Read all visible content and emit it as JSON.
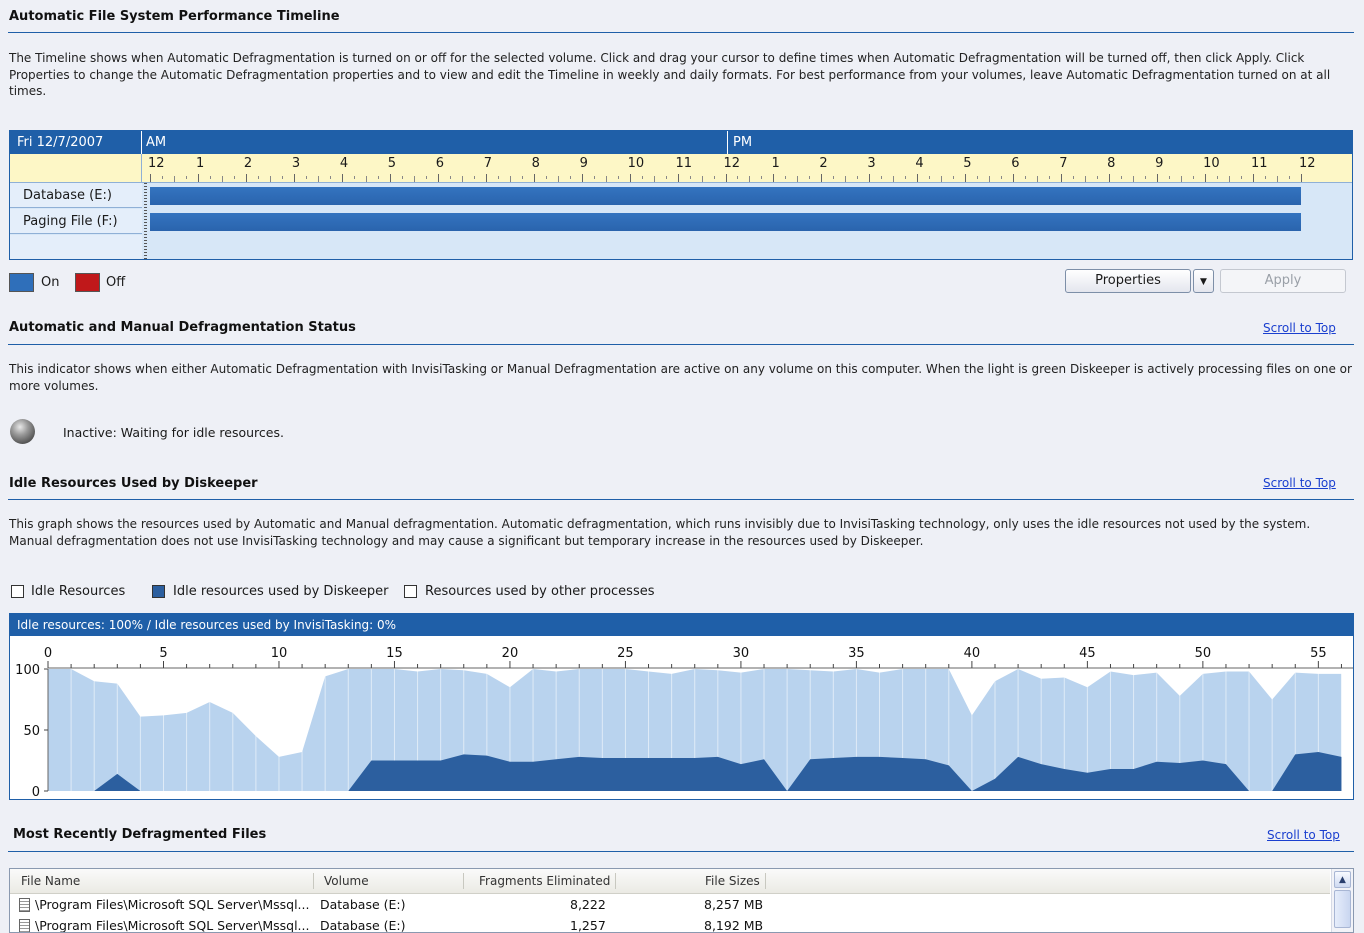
{
  "timeline_section": {
    "title": "Automatic File System Performance Timeline",
    "description": "The Timeline shows when Automatic Defragmentation is turned on or off for the selected volume. Click and drag your cursor to define times when Automatic Defragmentation will be turned off, then click Apply. Click Properties to change the Automatic Defragmentation properties and to view and edit the Timeline in weekly and daily formats. For best performance from your volumes, leave Automatic Defragmentation turned on at all times.",
    "date": "Fri 12/7/2007",
    "am_label": "AM",
    "pm_label": "PM",
    "hours": [
      "12",
      "1",
      "2",
      "3",
      "4",
      "5",
      "6",
      "7",
      "8",
      "9",
      "10",
      "11",
      "12",
      "1",
      "2",
      "3",
      "4",
      "5",
      "6",
      "7",
      "8",
      "9",
      "10",
      "11",
      "12"
    ],
    "volumes": [
      {
        "name": "Database (E:)",
        "state": "On"
      },
      {
        "name": "Paging File (F:)",
        "state": "On"
      }
    ],
    "legend_on": "On",
    "legend_off": "Off",
    "properties_button": "Properties",
    "apply_button": "Apply",
    "colors": {
      "on": "#2f6fba",
      "off": "#c0181a",
      "header": "#1f5fa8"
    }
  },
  "status_section": {
    "title": "Automatic and Manual Defragmentation Status",
    "scroll_link": "Scroll to Top",
    "description": "This indicator shows when either Automatic Defragmentation with InvisiTasking or Manual Defragmentation are active on any volume on this computer. When the light is green Diskeeper is actively processing files on one or more volumes.",
    "status_text": "Inactive: Waiting for idle resources."
  },
  "idle_section": {
    "title": "Idle Resources Used by Diskeeper",
    "scroll_link": "Scroll to Top",
    "description": "This graph shows the resources used by Automatic and Manual defragmentation. Automatic defragmentation, which runs invisibly due to InvisiTasking technology, only uses the idle resources not used by the system. Manual defragmentation does not use InvisiTasking technology and may cause a significant but temporary increase in the resources used by Diskeeper.",
    "legend": [
      "Idle Resources",
      "Idle resources used by Diskeeper",
      "Resources used by other processes"
    ],
    "graph_header": "Idle resources: 100% / Idle resources used by InvisiTasking: 0%"
  },
  "chart_data": {
    "type": "area",
    "x_ticks": [
      "0",
      "5",
      "10",
      "15",
      "20",
      "25",
      "30",
      "35",
      "40",
      "45",
      "50",
      "55"
    ],
    "y_ticks": [
      "100",
      "50",
      "0"
    ],
    "xlim": [
      0,
      56.5
    ],
    "ylim": [
      0,
      100
    ],
    "x": [
      0,
      1,
      2,
      3,
      4,
      5,
      6,
      7,
      8,
      9,
      10,
      11,
      12,
      13,
      14,
      15,
      16,
      17,
      18,
      19,
      20,
      21,
      22,
      23,
      24,
      25,
      26,
      27,
      28,
      29,
      30,
      31,
      32,
      33,
      34,
      35,
      36,
      37,
      38,
      39,
      40,
      41,
      42,
      43,
      44,
      45,
      46,
      47,
      48,
      49,
      50,
      51,
      52,
      53,
      54,
      55,
      56
    ],
    "series": [
      {
        "name": "Idle Resources",
        "color": "#b9d3ee",
        "values": [
          100,
          100,
          90,
          88,
          61,
          62,
          64,
          73,
          64,
          45,
          28,
          32,
          94,
          100,
          100,
          100,
          98,
          100,
          99,
          96,
          85,
          100,
          98,
          100,
          100,
          100,
          98,
          96,
          100,
          99,
          97,
          100,
          100,
          99,
          98,
          100,
          97,
          100,
          100,
          100,
          62,
          90,
          100,
          92,
          93,
          85,
          98,
          95,
          97,
          78,
          96,
          98,
          98,
          75,
          97,
          96,
          96
        ]
      },
      {
        "name": "Idle resources used by Diskeeper",
        "color": "#2c5f9f",
        "values": [
          0,
          0,
          0,
          14,
          0,
          0,
          0,
          0,
          0,
          0,
          0,
          0,
          0,
          0,
          25,
          25,
          25,
          25,
          30,
          29,
          24,
          24,
          26,
          28,
          27,
          27,
          27,
          27,
          27,
          28,
          22,
          26,
          0,
          26,
          27,
          28,
          28,
          27,
          26,
          21,
          0,
          10,
          28,
          22,
          18,
          15,
          18,
          18,
          24,
          23,
          25,
          22,
          0,
          0,
          30,
          32,
          28
        ]
      }
    ]
  },
  "files_section": {
    "title": "Most Recently Defragmented Files",
    "scroll_link": "Scroll to Top",
    "columns": [
      "File Name",
      "Volume",
      "Fragments Eliminated",
      "File Sizes"
    ],
    "rows": [
      {
        "file": "\\Program Files\\Microsoft SQL Server\\Mssql...",
        "volume": "Database (E:)",
        "fragments": "8,222",
        "size": "8,257 MB"
      },
      {
        "file": "\\Program Files\\Microsoft SQL Server\\Mssql...",
        "volume": "Database (E:)",
        "fragments": "1,257",
        "size": "8,192 MB"
      }
    ]
  }
}
